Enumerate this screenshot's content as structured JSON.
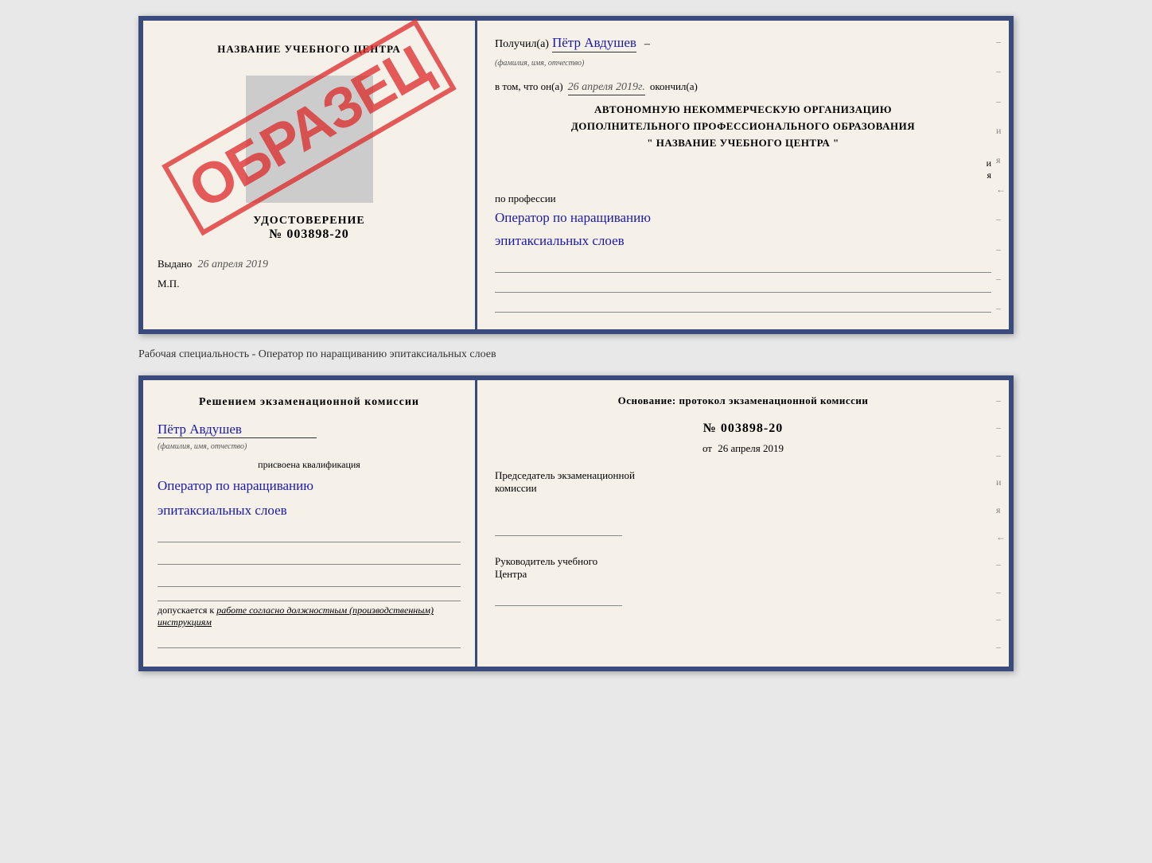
{
  "top_doc": {
    "left": {
      "school_name": "НАЗВАНИЕ УЧЕБНОГО ЦЕНТРА",
      "stamp_text": "ОБРАЗЕЦ",
      "udostoverenie_label": "УДОСТОВЕРЕНИЕ",
      "udostoverenie_number": "№ 003898-20",
      "vydano_label": "Выдано",
      "vydano_date": "26 апреля 2019",
      "mp_label": "М.П."
    },
    "right": {
      "poluchil_label": "Получил(а)",
      "fio_value": "Пётр Авдушев",
      "fio_subtitle": "(фамилия, имя, отчество)",
      "vtom_label": "в том, что он(а)",
      "date_value": "26 апреля 2019г.",
      "okonchil_label": "окончил(а)",
      "org_line1": "АВТОНОМНУЮ НЕКОММЕРЧЕСКУЮ ОРГАНИЗАЦИЮ",
      "org_line2": "ДОПОЛНИТЕЛЬНОГО ПРОФЕССИОНАЛЬНОГО ОБРАЗОВАНИЯ",
      "org_line3": "\"   НАЗВАНИЕ УЧЕБНОГО ЦЕНТРА   \"",
      "poprofessii_label": "по профессии",
      "profession_line1": "Оператор по наращиванию",
      "profession_line2": "эпитаксиальных слоев"
    }
  },
  "middle_text": "Рабочая специальность - Оператор по наращиванию эпитаксиальных слоев",
  "bottom_doc": {
    "left": {
      "resheniem_title": "Решением  экзаменационной  комиссии",
      "fio_value": "Пётр Авдушев",
      "fio_subtitle": "(фамилия, имя, отчество)",
      "prisvoena_label": "присвоена квалификация",
      "qual_line1": "Оператор по наращиванию",
      "qual_line2": "эпитаксиальных слоев",
      "dopuskaetsya_label": "допускается к",
      "work_text": "работе согласно должностным (производственным) инструкциям"
    },
    "right": {
      "osnovanie_title": "Основание: протокол экзаменационной  комиссии",
      "protocol_number": "№  003898-20",
      "ot_label": "от",
      "ot_date": "26 апреля 2019",
      "predsedatel_line1": "Председатель экзаменационной",
      "predsedatel_line2": "комиссии",
      "rukovoditel_line1": "Руководитель учебного",
      "rukovoditel_line2": "Центра"
    }
  },
  "spine": {
    "and_label": "и",
    "ya_label": "я",
    "left_arrow": "←",
    "minus_labels": [
      "–",
      "–",
      "–",
      "–",
      "–",
      "–",
      "–",
      "–"
    ]
  }
}
